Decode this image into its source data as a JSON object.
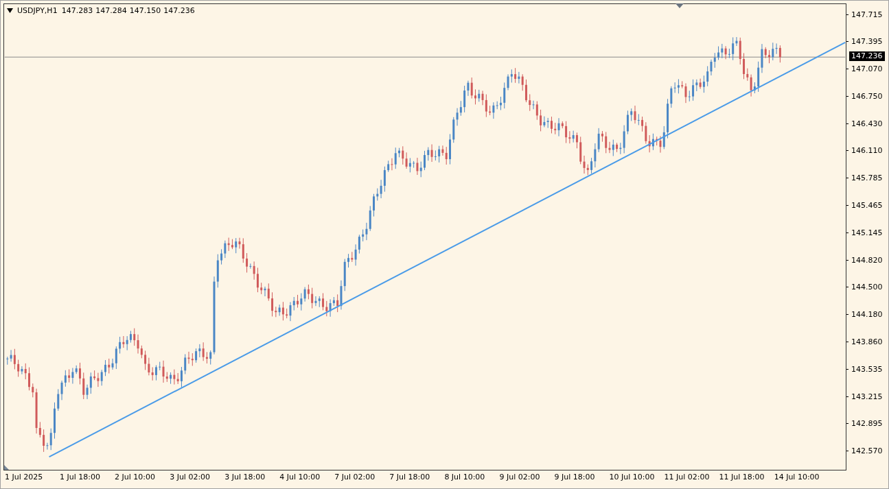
{
  "header": {
    "symbol": "USDJPY,H1",
    "prices": [
      "147.283",
      "147.284",
      "147.150",
      "147.236"
    ]
  },
  "price_axis": {
    "ticks": [
      "147.715",
      "147.395",
      "147.070",
      "146.750",
      "146.430",
      "146.110",
      "145.785",
      "145.465",
      "145.145",
      "144.820",
      "144.500",
      "144.180",
      "143.860",
      "143.535",
      "143.215",
      "142.895",
      "142.570"
    ],
    "current": "147.236"
  },
  "time_axis": {
    "labels": [
      "1 Jul 2025",
      "1 Jul 18:00",
      "2 Jul 10:00",
      "3 Jul 02:00",
      "3 Jul 18:00",
      "4 Jul 10:00",
      "7 Jul 02:00",
      "7 Jul 18:00",
      "8 Jul 10:00",
      "9 Jul 02:00",
      "9 Jul 18:00",
      "10 Jul 10:00",
      "11 Jul 02:00",
      "11 Jul 18:00",
      "14 Jul 10:00"
    ]
  }
}
